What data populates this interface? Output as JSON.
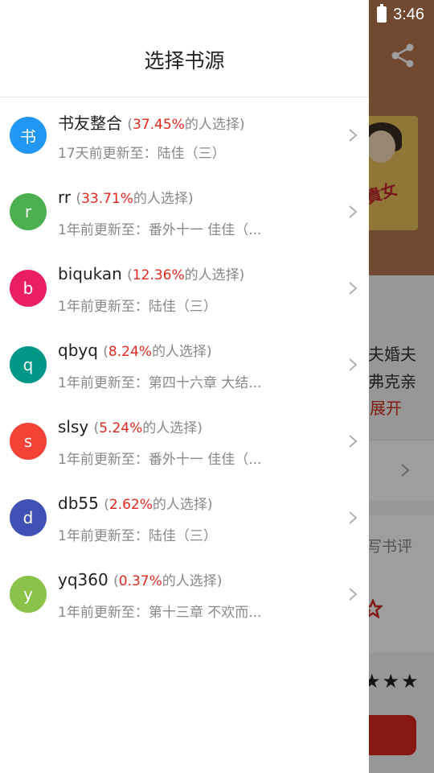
{
  "status_bar": {
    "time": "3:46"
  },
  "background": {
    "book_cover_title": "貴女",
    "desc_line1": "夫婚夫",
    "desc_line2": "弗克亲",
    "expand_label": "展开",
    "write_review_label": "写书评",
    "stars": "★★★"
  },
  "drawer": {
    "title": "选择书源",
    "pct_suffix": "的人选择)",
    "pct_prefix": "(",
    "items": [
      {
        "avatar": "书",
        "color": "#2196f3",
        "name": "书友整合",
        "pct": "37.45%",
        "sub": "17天前更新至：陆佳（三）"
      },
      {
        "avatar": "r",
        "color": "#4caf50",
        "name": "rr",
        "pct": "33.71%",
        "sub": "1年前更新至：番外十一 佳佳（..."
      },
      {
        "avatar": "b",
        "color": "#e91e63",
        "name": "biqukan",
        "pct": "12.36%",
        "sub": "1年前更新至：陆佳（三）"
      },
      {
        "avatar": "q",
        "color": "#009688",
        "name": "qbyq",
        "pct": "8.24%",
        "sub": "1年前更新至：第四十六章 大结..."
      },
      {
        "avatar": "s",
        "color": "#f44336",
        "name": "slsy",
        "pct": "5.24%",
        "sub": "1年前更新至：番外十一 佳佳（..."
      },
      {
        "avatar": "d",
        "color": "#3f51b5",
        "name": "db55",
        "pct": "2.62%",
        "sub": "1年前更新至：陆佳（三）"
      },
      {
        "avatar": "y",
        "color": "#8bc34a",
        "name": "yq360",
        "pct": "0.37%",
        "sub": "1年前更新至：第十三章 不欢而..."
      }
    ]
  }
}
